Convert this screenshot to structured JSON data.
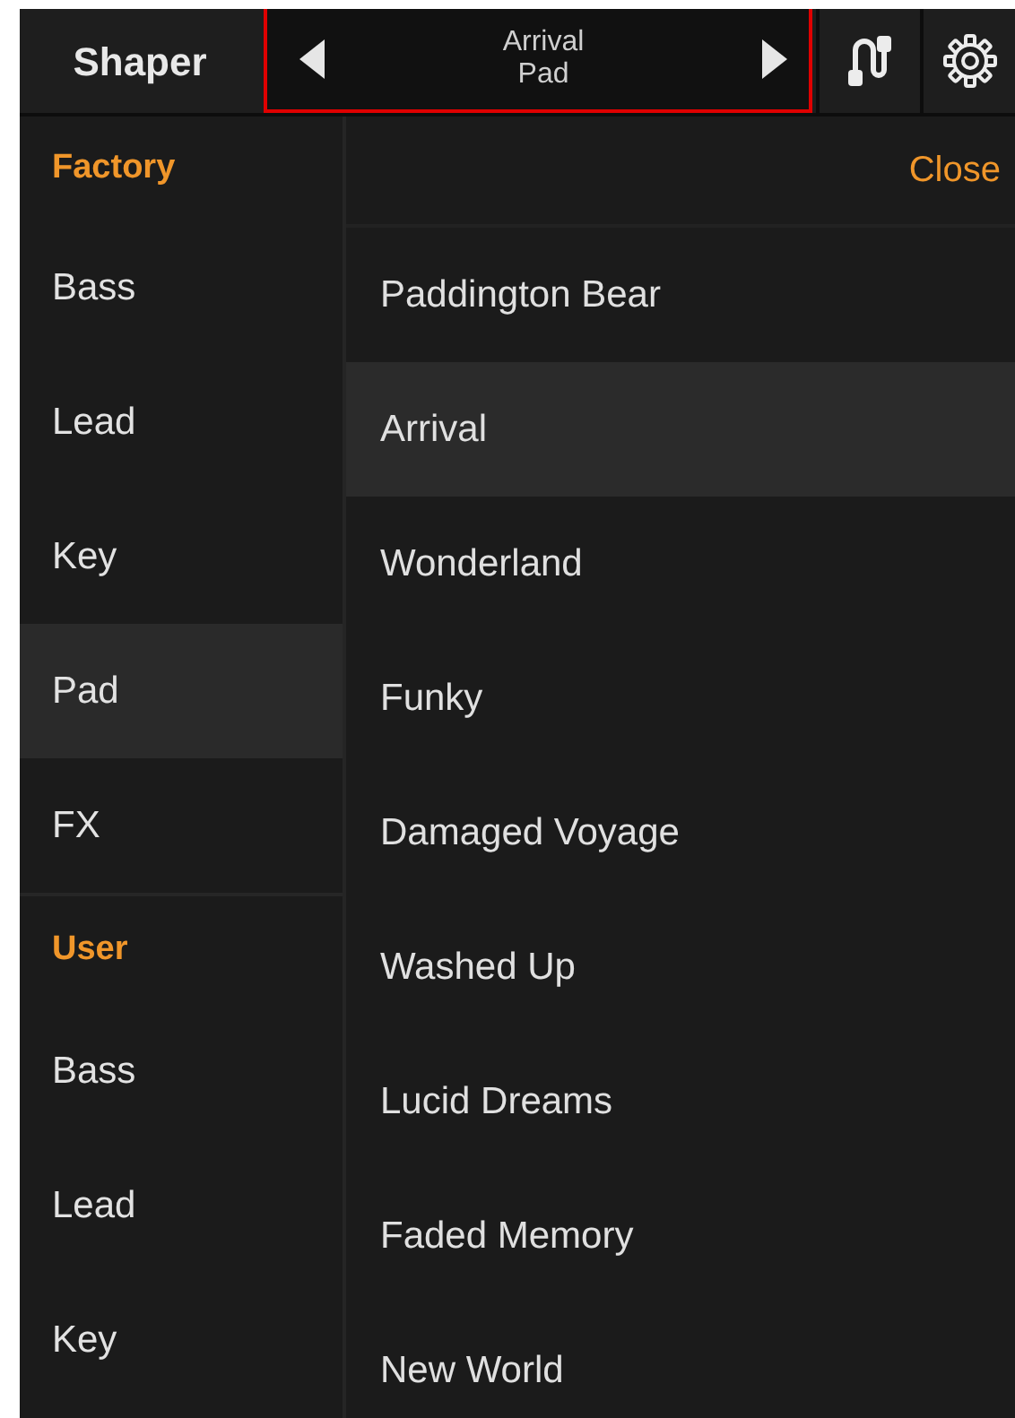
{
  "header": {
    "title": "Shaper",
    "preset": {
      "name": "Arrival",
      "category": "Pad"
    }
  },
  "sidebar": {
    "groups": [
      {
        "heading": "Factory",
        "items": [
          {
            "label": "Bass",
            "selected": false
          },
          {
            "label": "Lead",
            "selected": false
          },
          {
            "label": "Key",
            "selected": false
          },
          {
            "label": "Pad",
            "selected": true
          },
          {
            "label": "FX",
            "selected": false
          }
        ]
      },
      {
        "heading": "User",
        "items": [
          {
            "label": "Bass",
            "selected": false
          },
          {
            "label": "Lead",
            "selected": false
          },
          {
            "label": "Key",
            "selected": false
          }
        ]
      }
    ]
  },
  "close_button": "Close",
  "presets": [
    {
      "label": "Paddington Bear",
      "selected": false
    },
    {
      "label": "Arrival",
      "selected": true
    },
    {
      "label": "Wonderland",
      "selected": false
    },
    {
      "label": "Funky",
      "selected": false
    },
    {
      "label": "Damaged Voyage",
      "selected": false
    },
    {
      "label": "Washed Up",
      "selected": false
    },
    {
      "label": "Lucid Dreams",
      "selected": false
    },
    {
      "label": "Faded Memory",
      "selected": false
    },
    {
      "label": "New World",
      "selected": false
    }
  ]
}
